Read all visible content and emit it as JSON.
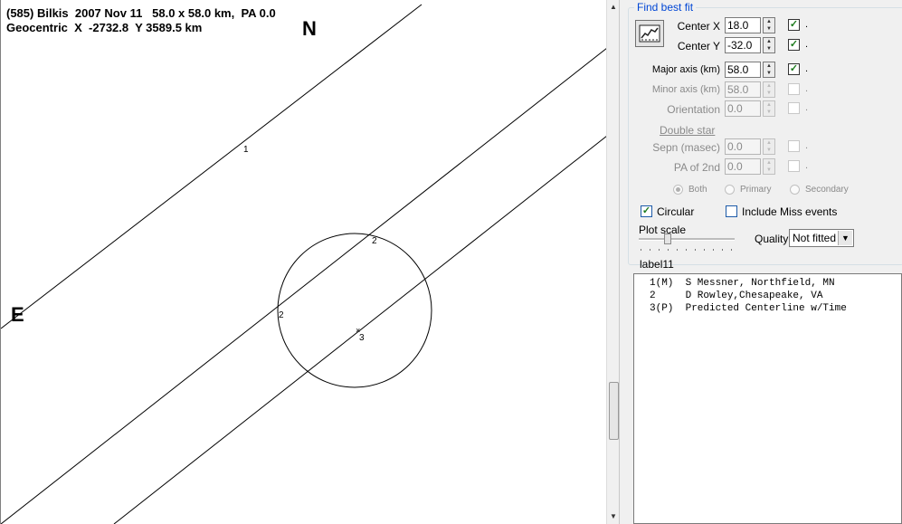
{
  "plot": {
    "header_line1": "(585) Bilkis  2007 Nov 11   58.0 x 58.0 km,  PA 0.0",
    "header_line2": "Geocentric  X  -2732.8  Y 3589.5 km",
    "north_label": "N",
    "east_label": "E",
    "chord_labels": [
      "1",
      "2",
      "2",
      "3"
    ]
  },
  "panel": {
    "group_title": "Find best fit",
    "fit_button_icon": "chart-fit-icon",
    "center_x": {
      "label": "Center X",
      "value": "18.0",
      "fixed_checked": true
    },
    "center_y": {
      "label": "Center Y",
      "value": "-32.0",
      "fixed_checked": true
    },
    "major_axis": {
      "label": "Major axis (km)",
      "value": "58.0",
      "fixed_checked": true
    },
    "minor_axis": {
      "label": "Minor axis (km)",
      "value": "58.0",
      "fixed_checked": false
    },
    "orientation": {
      "label": "Orientation",
      "value": "0.0",
      "fixed_checked": false
    },
    "double_star_label": "Double star",
    "sepn": {
      "label": "Sepn (masec)",
      "value": "0.0"
    },
    "pa_2nd": {
      "label": "PA of 2nd",
      "value": "0.0"
    },
    "radio": [
      "Both",
      "Primary",
      "Secondary"
    ],
    "circular": {
      "label": "Circular",
      "checked": true
    },
    "include_miss": {
      "label": "Include Miss events",
      "checked": false
    },
    "plot_scale_label": "Plot scale",
    "quality_label": "Quality",
    "quality_value": "Not fitted",
    "list_label": "label11",
    "list_items": [
      "1(M)  S Messner, Northfield, MN",
      "2     D Rowley,Chesapeake, VA",
      "3(P)  Predicted Centerline w/Time"
    ],
    "dot": "."
  },
  "colors": {
    "group_title": "#0046d5",
    "checkmark": "#1c7a1c"
  }
}
